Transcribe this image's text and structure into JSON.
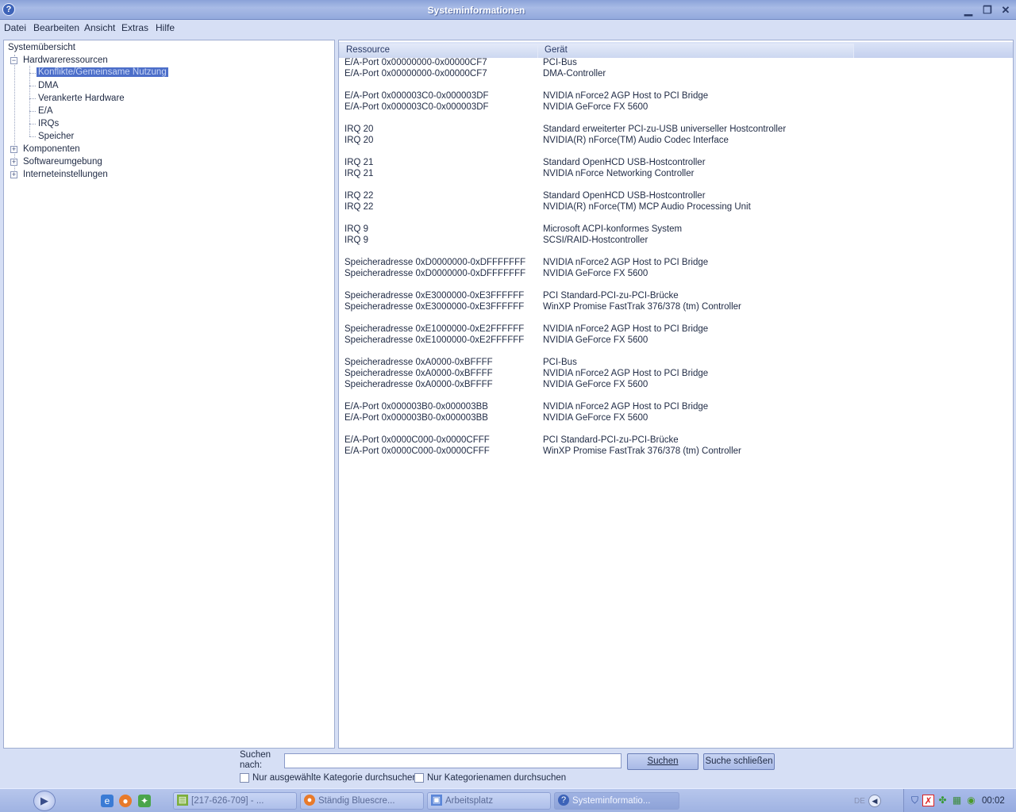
{
  "window": {
    "title": "Systeminformationen",
    "icon": "help-icon",
    "minimize_glyph": "▁",
    "maximize_glyph": "❐",
    "close_glyph": "✕"
  },
  "menu": [
    "Datei",
    "Bearbeiten",
    "Ansicht",
    "Extras",
    "Hilfe"
  ],
  "tree": {
    "root": "Systemübersicht",
    "groups": [
      {
        "label": "Hardwareressourcen",
        "expanded": true,
        "children": [
          "Konflikte/Gemeinsame Nutzung",
          "DMA",
          "Verankerte Hardware",
          "E/A",
          "IRQs",
          "Speicher"
        ],
        "selected": "Konflikte/Gemeinsame Nutzung"
      },
      {
        "label": "Komponenten",
        "expanded": false
      },
      {
        "label": "Softwareumgebung",
        "expanded": false
      },
      {
        "label": "Interneteinstellungen",
        "expanded": false
      }
    ],
    "expand_glyph": "+",
    "collapse_glyph": "−"
  },
  "table": {
    "columns": [
      "Ressource",
      "Gerät"
    ],
    "rows": [
      [
        "E/A-Port 0x00000000-0x00000CF7",
        "PCI-Bus"
      ],
      [
        "E/A-Port 0x00000000-0x00000CF7",
        "DMA-Controller"
      ],
      [
        "",
        ""
      ],
      [
        "E/A-Port 0x000003C0-0x000003DF",
        "NVIDIA nForce2 AGP Host to PCI Bridge"
      ],
      [
        "E/A-Port 0x000003C0-0x000003DF",
        "NVIDIA GeForce FX 5600"
      ],
      [
        "",
        ""
      ],
      [
        "IRQ 20",
        "Standard erweiterter PCI-zu-USB universeller Hostcontroller"
      ],
      [
        "IRQ 20",
        "NVIDIA(R) nForce(TM) Audio Codec Interface"
      ],
      [
        "",
        ""
      ],
      [
        "IRQ 21",
        "Standard OpenHCD USB-Hostcontroller"
      ],
      [
        "IRQ 21",
        "NVIDIA nForce Networking Controller"
      ],
      [
        "",
        ""
      ],
      [
        "IRQ 22",
        "Standard OpenHCD USB-Hostcontroller"
      ],
      [
        "IRQ 22",
        "NVIDIA(R) nForce(TM) MCP Audio Processing Unit"
      ],
      [
        "",
        ""
      ],
      [
        "IRQ 9",
        "Microsoft ACPI-konformes System"
      ],
      [
        "IRQ 9",
        "SCSI/RAID-Hostcontroller"
      ],
      [
        "",
        ""
      ],
      [
        "Speicheradresse 0xD0000000-0xDFFFFFFF",
        "NVIDIA nForce2 AGP Host to PCI Bridge"
      ],
      [
        "Speicheradresse 0xD0000000-0xDFFFFFFF",
        "NVIDIA GeForce FX 5600"
      ],
      [
        "",
        ""
      ],
      [
        "Speicheradresse 0xE3000000-0xE3FFFFFF",
        "PCI Standard-PCI-zu-PCI-Brücke"
      ],
      [
        "Speicheradresse 0xE3000000-0xE3FFFFFF",
        "WinXP Promise FastTrak 376/378 (tm) Controller"
      ],
      [
        "",
        ""
      ],
      [
        "Speicheradresse 0xE1000000-0xE2FFFFFF",
        "NVIDIA nForce2 AGP Host to PCI Bridge"
      ],
      [
        "Speicheradresse 0xE1000000-0xE2FFFFFF",
        "NVIDIA GeForce FX 5600"
      ],
      [
        "",
        ""
      ],
      [
        "Speicheradresse 0xA0000-0xBFFFF",
        "PCI-Bus"
      ],
      [
        "Speicheradresse 0xA0000-0xBFFFF",
        "NVIDIA nForce2 AGP Host to PCI Bridge"
      ],
      [
        "Speicheradresse 0xA0000-0xBFFFF",
        "NVIDIA GeForce FX 5600"
      ],
      [
        "",
        ""
      ],
      [
        "E/A-Port 0x000003B0-0x000003BB",
        "NVIDIA nForce2 AGP Host to PCI Bridge"
      ],
      [
        "E/A-Port 0x000003B0-0x000003BB",
        "NVIDIA GeForce FX 5600"
      ],
      [
        "",
        ""
      ],
      [
        "E/A-Port 0x0000C000-0x0000CFFF",
        "PCI Standard-PCI-zu-PCI-Brücke"
      ],
      [
        "E/A-Port 0x0000C000-0x0000CFFF",
        "WinXP Promise FastTrak 376/378 (tm) Controller"
      ]
    ]
  },
  "search": {
    "label_line1": "Suchen",
    "label_line2": "nach:",
    "value": "",
    "search_button": "Suchen",
    "close_button": "Suche schließen",
    "option_selected_category": "Nur ausgewählte Kategorie durchsuchen",
    "option_category_names": "Nur Kategorienamen durchsuchen"
  },
  "taskbar": {
    "start_glyph": "▶",
    "quick_launch": [
      "ie-icon",
      "firefox-icon",
      "network-icon"
    ],
    "tasks": [
      {
        "label": "[217-626-709] - ...",
        "icon": "chat-icon",
        "active": false
      },
      {
        "label": "Ständig Bluescre...",
        "icon": "firefox-icon",
        "active": false
      },
      {
        "label": "Arbeitsplatz",
        "icon": "computer-icon",
        "active": false
      },
      {
        "label": "Systeminformatio...",
        "icon": "help-icon",
        "active": true
      }
    ],
    "language": "DE",
    "clock": "00:02"
  },
  "colors": {
    "selection": "#4c6ec9",
    "window_bg": "#d6dff5",
    "title_bar": "#93a9dc"
  }
}
